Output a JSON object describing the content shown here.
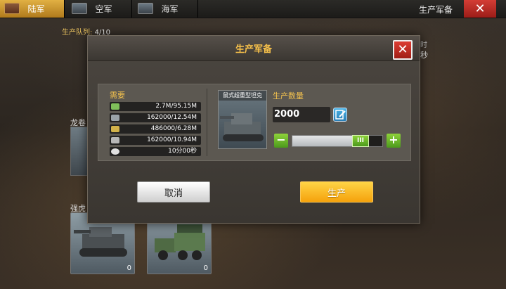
{
  "tabs": [
    {
      "label": "陆军",
      "active": true,
      "icon": "army-icon"
    },
    {
      "label": "空军",
      "active": false,
      "icon": "airforce-icon"
    },
    {
      "label": "海军",
      "active": false,
      "icon": "navy-icon"
    }
  ],
  "header": {
    "title": "生产军备",
    "close": "✕"
  },
  "queue": {
    "label": "生产队列:",
    "value": "4/10"
  },
  "side": {
    "time_label": "时",
    "seconds_label": "秒"
  },
  "background_units": {
    "label_dragon": "龙卷",
    "label_tiger": "强虎",
    "card1_count": "0",
    "card2_count": "0"
  },
  "modal": {
    "title": "生产军备",
    "close": "✕",
    "requirements_title": "需要",
    "requirements": [
      {
        "icon": "money-icon",
        "value": "2.7M/95.15M",
        "color": "#7fbf5a"
      },
      {
        "icon": "steel-icon",
        "value": "162000/12.54M",
        "color": "#9aa3a8"
      },
      {
        "icon": "oil-icon",
        "value": "486000/6.28M",
        "color": "#d2b24a"
      },
      {
        "icon": "rare-earth-icon",
        "value": "162000/10.94M",
        "color": "#b7b7b7"
      },
      {
        "icon": "time-icon",
        "value": "10分00秒",
        "color": "#e0e0e0"
      }
    ],
    "unit_name": "鼠式超重型坦克",
    "quantity_label": "生产数量",
    "quantity": "2000",
    "slider_level": 0.82,
    "slider_knob": "III",
    "minus": "−",
    "plus": "+",
    "cancel": "取消",
    "produce": "生产"
  },
  "colors": {
    "accent": "#f2c14e",
    "danger": "#d33d35",
    "go": "#f5a20c",
    "slider": "#8ed23a"
  }
}
